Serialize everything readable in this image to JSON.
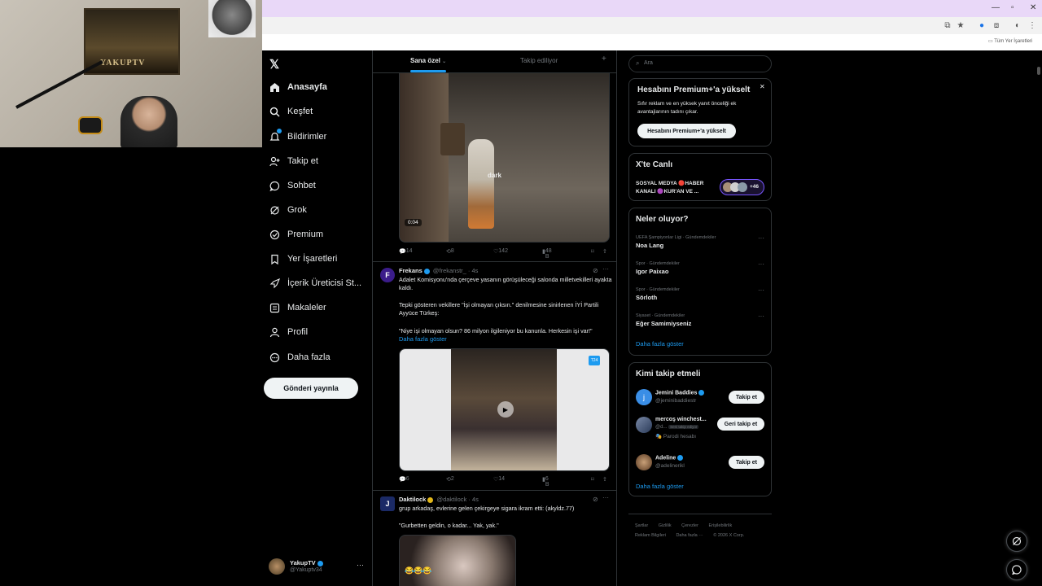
{
  "webcam": {
    "poster_text": "YAKUPTV"
  },
  "browser": {
    "bookmarks_label": "Tüm Yer İşaretleri",
    "colors": {
      "tab_bar": "#e9d8f8",
      "address_bar": "#f2f2f2"
    }
  },
  "sidebar": {
    "items": [
      {
        "label": "Anasayfa",
        "icon": "home-icon"
      },
      {
        "label": "Keşfet",
        "icon": "search-icon"
      },
      {
        "label": "Bildirimler",
        "icon": "bell-icon"
      },
      {
        "label": "Takip et",
        "icon": "follow-icon"
      },
      {
        "label": "Sohbet",
        "icon": "chat-icon"
      },
      {
        "label": "Grok",
        "icon": "grok-icon"
      },
      {
        "label": "Premium",
        "icon": "premium-icon"
      },
      {
        "label": "Yer İşaretleri",
        "icon": "bookmark-icon"
      },
      {
        "label": "İçerik Üreticisi St...",
        "icon": "rocket-icon"
      },
      {
        "label": "Makaleler",
        "icon": "article-icon"
      },
      {
        "label": "Profil",
        "icon": "profile-icon"
      },
      {
        "label": "Daha fazla",
        "icon": "more-icon"
      }
    ],
    "post_button": "Gönderi yayınla",
    "account": {
      "name": "YakupTV",
      "handle": "@Yakuptv34"
    }
  },
  "feed": {
    "tabs": {
      "for_you": "Sana özel",
      "following": "Takip ediliyor"
    },
    "tweet1": {
      "video_time": "0:04",
      "watermark": "dark",
      "stats": {
        "replies": "14",
        "reposts": "8",
        "likes": "142",
        "views": "48 B"
      }
    },
    "tweet2": {
      "name": "Frekans",
      "handle": "@frekanstr_ · 4s",
      "text1": "Adalet Komisyonu'nda çerçeve yasanın görüşüleceği salonda milletvekilleri ayakta kaldı.",
      "text2": "Tepki gösteren vekillere \"İşi olmayan çıksın.\" denilmesine sinirlenen İYİ Partili Ayyüce Türkeş:",
      "text3": "\"Niye işi olmayan olsun? 86 milyon ilgileniyor bu kanunla. Herkesin işi var!\"",
      "show_more": "Daha fazla göster",
      "badge": "T24",
      "stats": {
        "replies": "6",
        "reposts": "2",
        "likes": "14",
        "views": "6 B"
      }
    },
    "tweet3": {
      "name": "Daktilock",
      "handle": "@daktilock · 4s",
      "text1": "grup arkadaş, evlerine gelen çekirgeye sigara ikram etti: (akyldz.77)",
      "text2": "\"Gurbetten geldin, o kadar... Yak, yak.\"",
      "emoji": "😂😂😂"
    }
  },
  "right": {
    "search_placeholder": "Ara",
    "premium": {
      "title": "Hesabını Premium+'a yükselt",
      "body": "Sıfır reklam ve en yüksek yanıt önceliği ek avantajlarının tadını çıkar.",
      "button": "Hesabını Premium+'a yükselt"
    },
    "live": {
      "title": "X'te Canlı",
      "name_line1": "SOSYAL MEDYA 🔴HABER",
      "name_line2": "KANALI 🟣KUR'AN VE ...",
      "count": "+46"
    },
    "trends": {
      "title": "Neler oluyor?",
      "items": [
        {
          "meta": "UEFA Şampiyonlar Ligi · Gündemdekiler",
          "name": "Noa Lang"
        },
        {
          "meta": "Spor · Gündemdekiler",
          "name": "Igor Paixao"
        },
        {
          "meta": "Spor · Gündemdekiler",
          "name": "Sörloth"
        },
        {
          "meta": "Siyaset · Gündemdekiler",
          "name": "Eğer Samimiyseniz"
        }
      ],
      "show_more": "Daha fazla göster"
    },
    "who_to_follow": {
      "title": "Kimi takip etmeli",
      "users": [
        {
          "name": "Jemini Baddies",
          "handle": "@jeminibaddiestr",
          "button": "Takip et"
        },
        {
          "name": "mercoş winchest...",
          "handle": "@d...",
          "badge": "Seni takip ediyor",
          "note": "Parodi hesabı",
          "button": "Geri takip et"
        },
        {
          "name": "Adeline",
          "handle": "@adelinerikl",
          "button": "Takip et"
        }
      ],
      "show_more": "Daha fazla göster"
    },
    "footer": {
      "row1": [
        "Şartlar",
        "Gizlilik",
        "Çerezler",
        "Erişilebilirlik"
      ],
      "row2": [
        "Reklam Bilgileri",
        "Daha fazla ···",
        "© 2026 X Corp."
      ]
    }
  }
}
